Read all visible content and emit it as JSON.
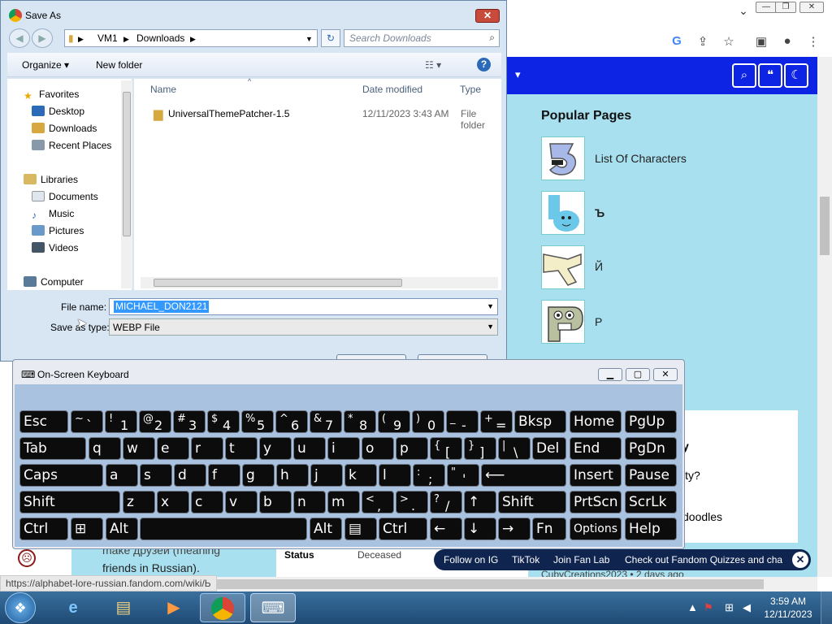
{
  "browser": {
    "url_status": "https://alphabet-lore-russian.fandom.com/wiki/Ь",
    "popular_pages_title": "Popular Pages",
    "popular_pages": [
      {
        "label": "List Of Characters"
      },
      {
        "label": "Ъ"
      },
      {
        "label": "Й"
      },
      {
        "label": "Р"
      }
    ],
    "text_fragment_y": "y",
    "text_fragment_ity": "ity?",
    "text_fragment_doodles": "doodles",
    "friends_text": "friends in Russian).",
    "make_text": "make друзей (meaning",
    "status_label": "Status",
    "status_value": "Deceased",
    "author": "CubyCreations2023 • 2 days ago",
    "follow_bar": {
      "items": [
        "Follow on IG",
        "TikTok",
        "Join Fan Lab",
        "Check out Fandom Quizzes and cha"
      ],
      "close": "✕"
    }
  },
  "save_dialog": {
    "title": "Save As",
    "address": [
      "VM1",
      "Downloads"
    ],
    "search_placeholder": "Search Downloads",
    "toolbar": {
      "organize": "Organize",
      "new_folder": "New folder"
    },
    "nav": {
      "favorites": "Favorites",
      "desktop": "Desktop",
      "downloads": "Downloads",
      "recent": "Recent Places",
      "libraries": "Libraries",
      "documents": "Documents",
      "music": "Music",
      "pictures": "Pictures",
      "videos": "Videos",
      "computer": "Computer"
    },
    "columns": {
      "name": "Name",
      "date": "Date modified",
      "type": "Type"
    },
    "files": [
      {
        "name": "UniversalThemePatcher-1.5",
        "date": "12/11/2023 3:43 AM",
        "type": "File folder"
      }
    ],
    "file_name_label": "File name:",
    "file_name_value": "MICHAEL_DON2121",
    "save_type_label": "Save as type:",
    "save_type_value": "WEBP File"
  },
  "osk": {
    "title": "On-Screen Keyboard",
    "keys": {
      "esc": "Esc",
      "bksp": "Bksp",
      "home": "Home",
      "pgup": "PgUp",
      "tab": "Tab",
      "del": "Del",
      "end": "End",
      "pgdn": "PgDn",
      "caps": "Caps",
      "insert": "Insert",
      "pause": "Pause",
      "shift": "Shift",
      "prtscn": "PrtScn",
      "scrlk": "ScrLk",
      "ctrl": "Ctrl",
      "alt": "Alt",
      "fn": "Fn",
      "options": "Options",
      "help": "Help"
    },
    "row1": [
      [
        "~",
        "`"
      ],
      [
        "!",
        "1"
      ],
      [
        "@",
        "2"
      ],
      [
        "#",
        "3"
      ],
      [
        "$",
        "4"
      ],
      [
        "%",
        "5"
      ],
      [
        "^",
        "6"
      ],
      [
        "&",
        "7"
      ],
      [
        "*",
        "8"
      ],
      [
        "(",
        "9"
      ],
      [
        ")",
        "0"
      ],
      [
        "_",
        "-"
      ],
      [
        "+",
        "="
      ]
    ],
    "row2": [
      "q",
      "w",
      "e",
      "r",
      "t",
      "y",
      "u",
      "i",
      "o",
      "p",
      [
        "{",
        "["
      ],
      [
        "}",
        "]"
      ],
      [
        "|",
        "\\"
      ]
    ],
    "row3": [
      "a",
      "s",
      "d",
      "f",
      "g",
      "h",
      "j",
      "k",
      "l",
      [
        ":",
        ";"
      ],
      [
        "\"",
        "'"
      ]
    ],
    "row4": [
      "z",
      "x",
      "c",
      "v",
      "b",
      "n",
      "m",
      [
        "<",
        ","
      ],
      [
        ">",
        "."
      ],
      [
        "?",
        "/"
      ]
    ]
  },
  "taskbar": {
    "time": "3:59 AM",
    "date": "12/11/2023"
  }
}
